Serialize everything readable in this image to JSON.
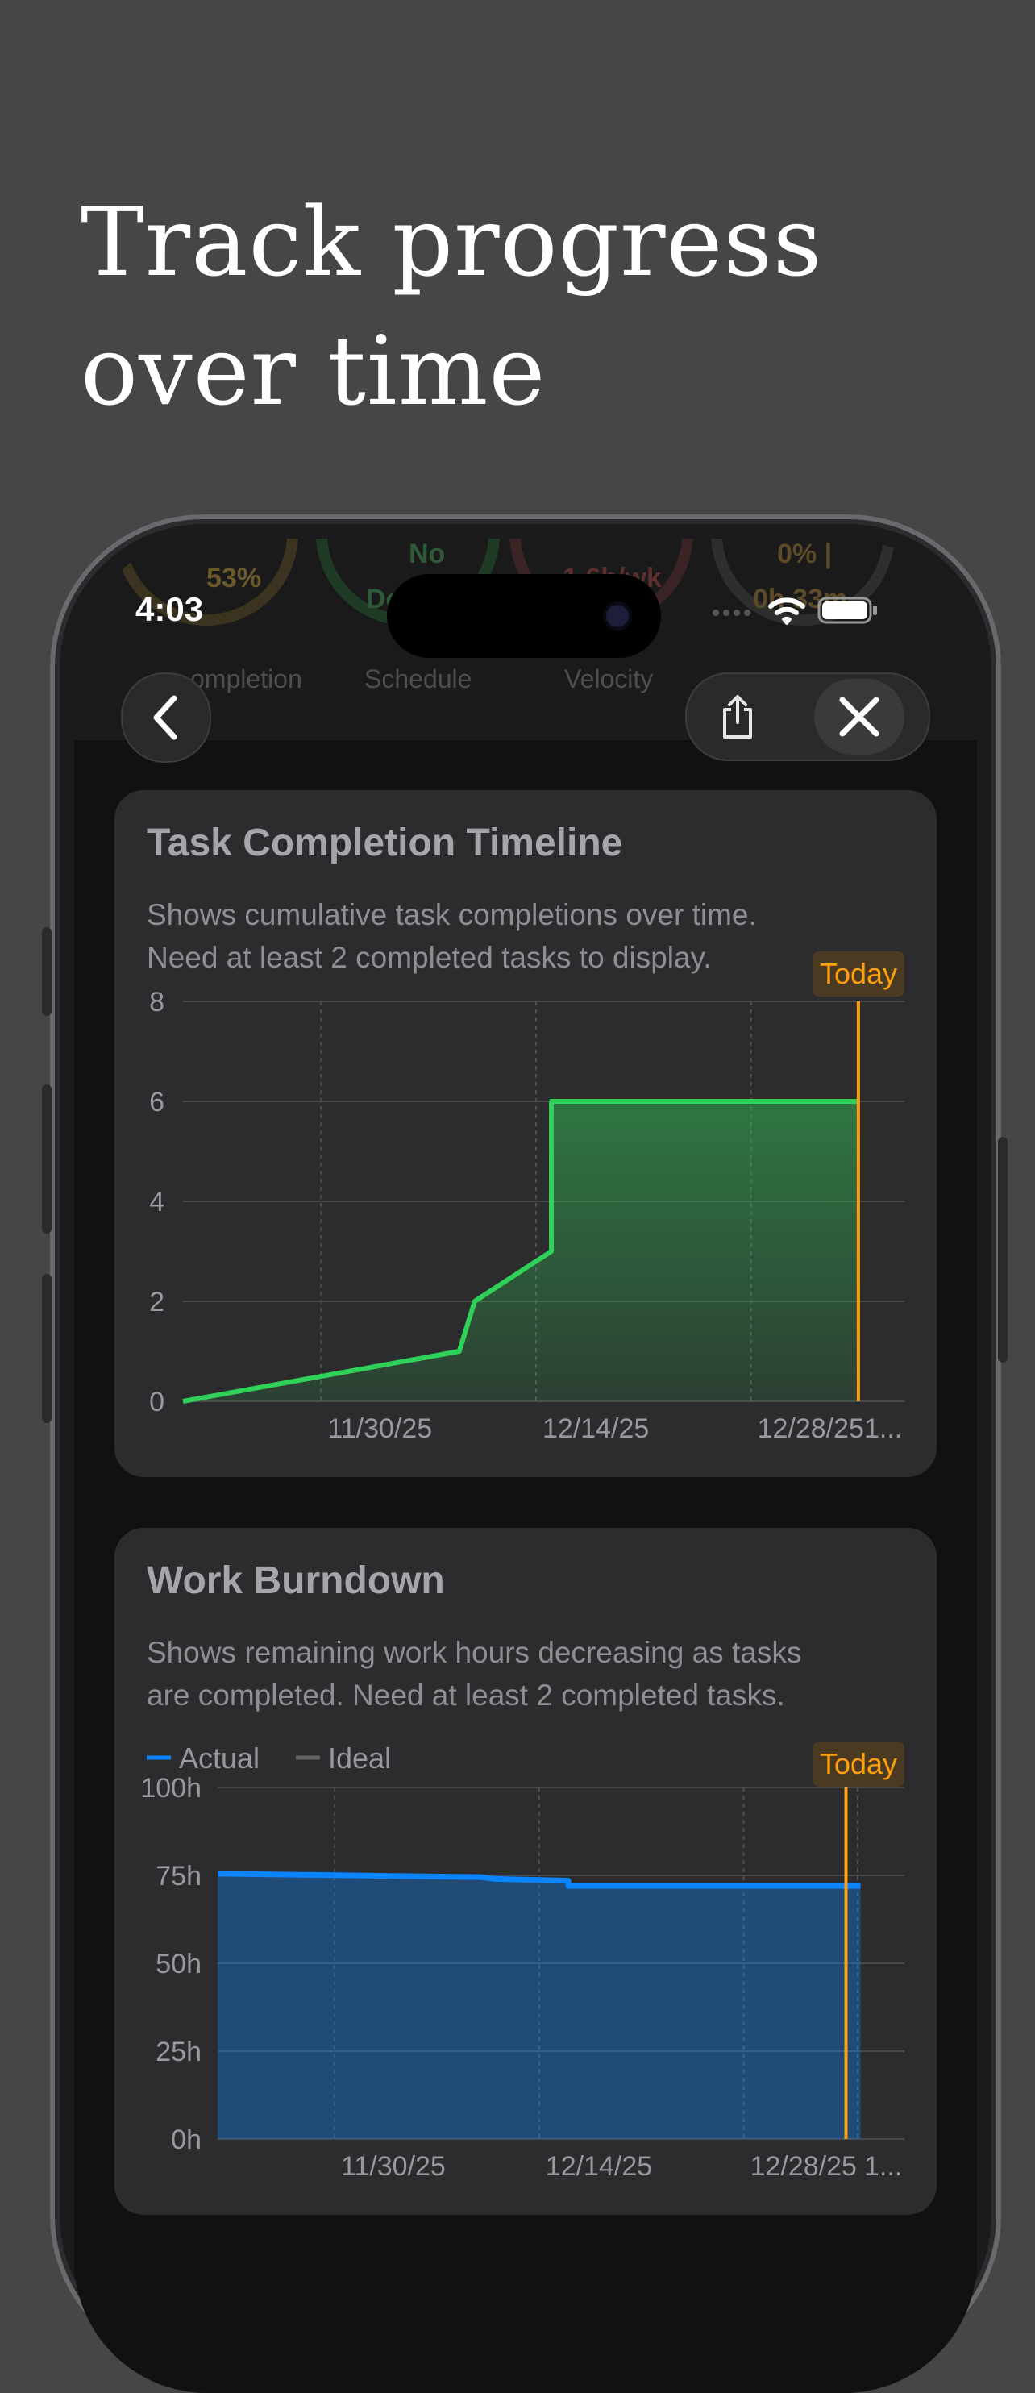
{
  "headline": {
    "line1": "Track progress",
    "line2": "over time"
  },
  "status_bar": {
    "time": "4:03"
  },
  "behind_header": {
    "items": [
      {
        "value": "53%",
        "label": "ompletion"
      },
      {
        "value": "No",
        "sub": "Do",
        "label": "Schedule"
      },
      {
        "value": "1.6h/wk",
        "label": "Velocity"
      },
      {
        "value": "0% |",
        "sub": "0h 33m",
        "label": "..."
      }
    ]
  },
  "nav": {
    "back_icon": "chevron-left-icon",
    "share_icon": "share-icon",
    "close_icon": "close-icon"
  },
  "colors": {
    "green": "#30d158",
    "blue": "#0a84ff",
    "orange": "#ff9f0a",
    "card": "#2c2c2e"
  },
  "cards": [
    {
      "title": "Task Completion Timeline",
      "desc_line1": "Shows cumulative task completions over time.",
      "desc_line2": "Need at least 2 completed tasks to display.",
      "today_label": "Today"
    },
    {
      "title": "Work Burndown",
      "desc_line1": "Shows remaining work hours decreasing as tasks",
      "desc_line2": "are completed. Need at least 2 completed tasks.",
      "today_label": "Today",
      "legend": [
        {
          "name": "Actual"
        },
        {
          "name": "Ideal"
        }
      ]
    }
  ],
  "chart_data": [
    {
      "type": "area",
      "title": "Task Completion Timeline",
      "x_tick_labels": [
        "11/30/25",
        "12/14/25",
        "12/28/25",
        "1..."
      ],
      "y_ticks": [
        0,
        2,
        4,
        6,
        8
      ],
      "ylim": [
        0,
        8
      ],
      "xlim": [
        "2025-11-21",
        "2026-01-07"
      ],
      "today": "2026-01-04",
      "series": [
        {
          "x": [
            "2025-11-21",
            "2025-12-09",
            "2025-12-10",
            "2025-12-15",
            "2025-12-15",
            "2026-01-04"
          ],
          "y": [
            0,
            1,
            2,
            3,
            6,
            6
          ]
        }
      ],
      "grid": true
    },
    {
      "type": "area",
      "title": "Work Burndown",
      "x_tick_labels": [
        "11/30/25",
        "12/14/25",
        "12/28/25",
        "1..."
      ],
      "y_ticks": [
        "0h",
        "25h",
        "50h",
        "75h",
        "100h"
      ],
      "ylim": [
        0,
        100
      ],
      "xlim": [
        "2025-11-22",
        "2026-01-08"
      ],
      "today": "2026-01-04",
      "series": [
        {
          "name": "Actual",
          "x": [
            "2025-11-22",
            "2025-12-10",
            "2025-12-11",
            "2025-12-16",
            "2025-12-16",
            "2026-01-05"
          ],
          "y": [
            75.5,
            74.5,
            74,
            73.5,
            72,
            72
          ]
        },
        {
          "name": "Ideal",
          "x": [],
          "y": []
        }
      ],
      "grid": true
    }
  ]
}
